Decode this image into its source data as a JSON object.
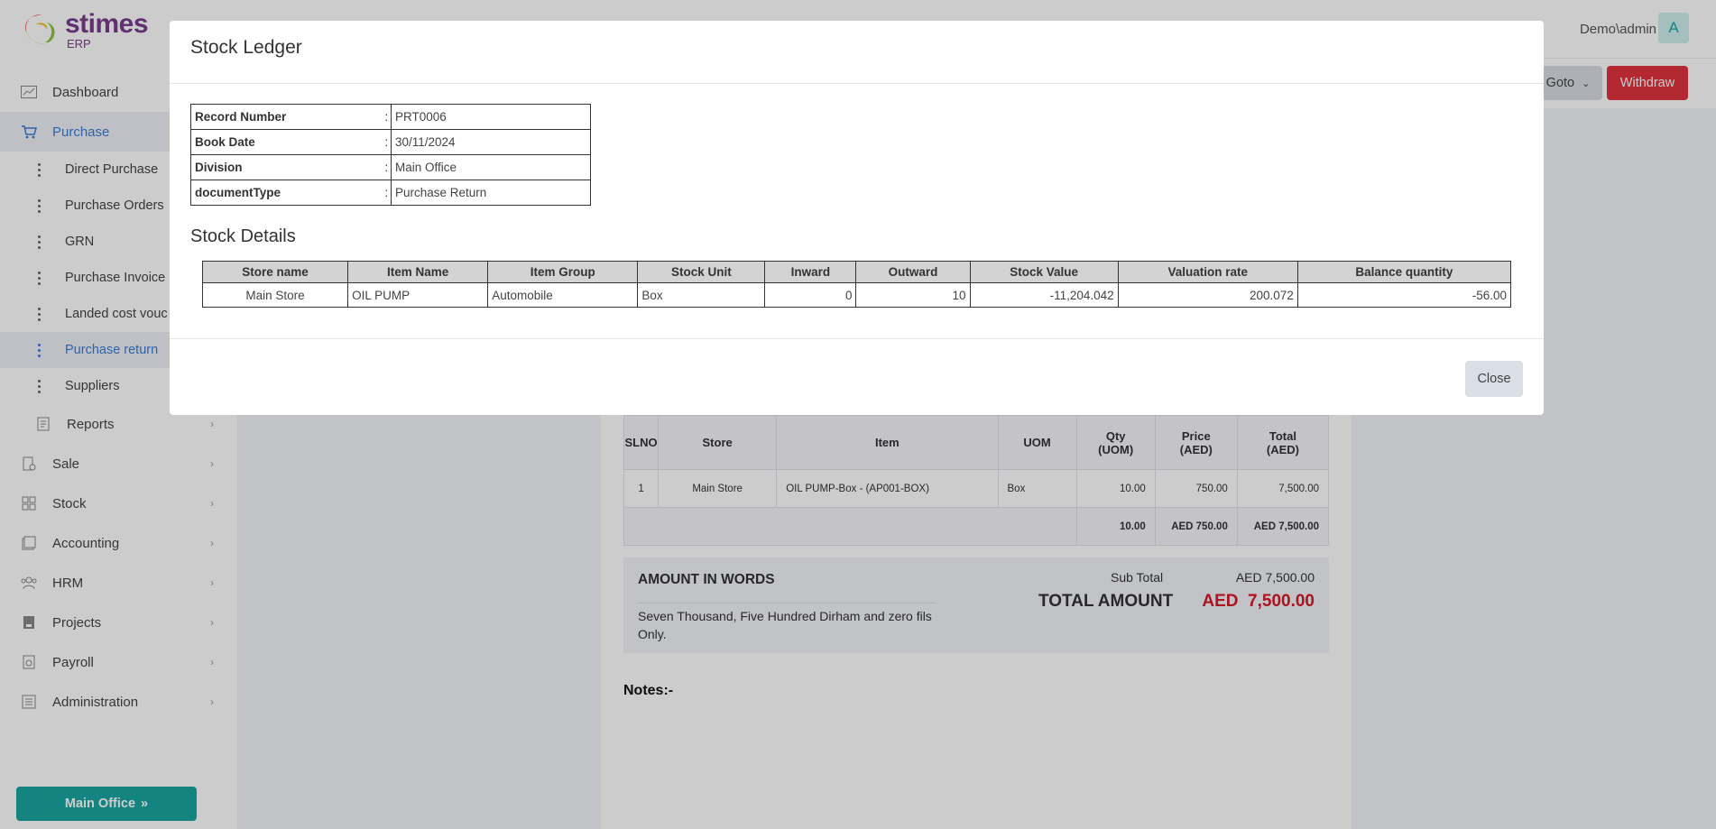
{
  "app": {
    "logo_title": "stimes",
    "logo_sub": "ERP"
  },
  "header": {
    "user": "Demo\\admin",
    "avatar": "A"
  },
  "toolbar": {
    "goto_label": "Goto",
    "withdraw_label": "Withdraw"
  },
  "sidebar": {
    "items": [
      {
        "label": "Dashboard",
        "icon": "chart-icon"
      },
      {
        "label": "Purchase",
        "icon": "cart-icon"
      },
      {
        "label": "Reports",
        "icon": "report-icon"
      },
      {
        "label": "Sale",
        "icon": "sale-icon"
      },
      {
        "label": "Stock",
        "icon": "grid-icon"
      },
      {
        "label": "Accounting",
        "icon": "accounting-icon"
      },
      {
        "label": "HRM",
        "icon": "people-icon"
      },
      {
        "label": "Projects",
        "icon": "projects-icon"
      },
      {
        "label": "Payroll",
        "icon": "payroll-icon"
      },
      {
        "label": "Administration",
        "icon": "admin-icon"
      }
    ],
    "purchase_sub": [
      "Direct Purchase",
      "Purchase Orders",
      "GRN",
      "Purchase Invoice",
      "Landed cost vouc",
      "Purchase return",
      "Suppliers"
    ],
    "office_button": "Main Office"
  },
  "document": {
    "columns": [
      "SLNO",
      "Store",
      "Item",
      "UOM",
      "Qty\n(UOM)",
      "Price\n(AED)",
      "Total\n(AED)"
    ],
    "rows": [
      [
        "1",
        "Main Store",
        "OIL PUMP-Box - (AP001-BOX)",
        "Box",
        "10.00",
        "750.00",
        "7,500.00"
      ]
    ],
    "totals": {
      "qty": "10.00",
      "price": "AED 750.00",
      "total": "AED 7,500.00"
    },
    "amount_in_words_title": "AMOUNT IN WORDS",
    "amount_in_words": "Seven Thousand, Five Hundred Dirham and zero fils Only.",
    "sub_total_label": "Sub Total",
    "sub_total_value": "AED 7,500.00",
    "total_label": "TOTAL AMOUNT",
    "total_value": "AED  7,500.00",
    "notes_label": "Notes:-"
  },
  "modal": {
    "title": "Stock Ledger",
    "info": [
      {
        "label": "Record Number",
        "value": "PRT0006"
      },
      {
        "label": "Book Date",
        "value": "30/11/2024"
      },
      {
        "label": "Division",
        "value": "Main Office"
      },
      {
        "label": "documentType",
        "value": "Purchase Return"
      }
    ],
    "section_title": "Stock Details",
    "columns": [
      "Store name",
      "Item Name",
      "Item Group",
      "Stock Unit",
      "Inward",
      "Outward",
      "Stock Value",
      "Valuation rate",
      "Balance quantity"
    ],
    "rows": [
      [
        "Main Store",
        "OIL PUMP",
        "Automobile",
        "Box",
        "0",
        "10",
        "-11,204.042",
        "200.072",
        "-56.00"
      ]
    ],
    "close_label": "Close"
  },
  "colors": {
    "brand": "#7a3d8c",
    "accent": "#1aa6a0",
    "danger": "#e0323e",
    "link": "#3a7bd5"
  }
}
